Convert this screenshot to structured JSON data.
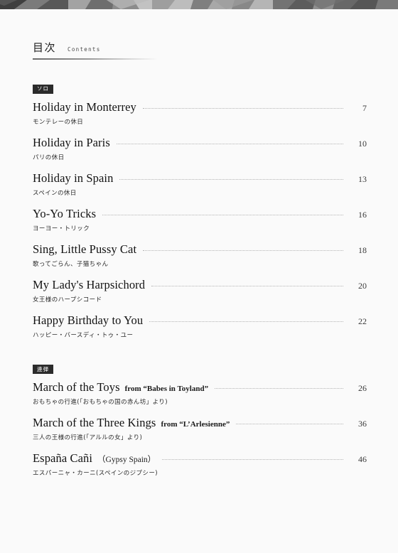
{
  "document": {
    "heading_ja": "目次",
    "heading_en": "Contents"
  },
  "sections": [
    {
      "badge": "ソロ",
      "entries": [
        {
          "title": "Holiday in Monterrey",
          "source": "",
          "subtitle_ja": "モンテレーの休日",
          "page": "7"
        },
        {
          "title": "Holiday in Paris",
          "source": "",
          "subtitle_ja": "パリの休日",
          "page": "10"
        },
        {
          "title": "Holiday in Spain",
          "source": "",
          "subtitle_ja": "スペインの休日",
          "page": "13"
        },
        {
          "title": "Yo-Yo Tricks",
          "source": "",
          "subtitle_ja": "ヨーヨー・トリック",
          "page": "16"
        },
        {
          "title": "Sing, Little Pussy Cat",
          "source": "",
          "subtitle_ja": "歌ってごらん、子猫ちゃん",
          "page": "18"
        },
        {
          "title": "My Lady's Harpsichord",
          "source": "",
          "subtitle_ja": "女王様のハープシコード",
          "page": "20"
        },
        {
          "title": "Happy Birthday to You",
          "source": "",
          "subtitle_ja": "ハッピー・バースディ・トゥ・ユー",
          "page": "22"
        }
      ]
    },
    {
      "badge": "連弾",
      "entries": [
        {
          "title": "March of the Toys",
          "source": "from “Babes in Toyland”",
          "subtitle_ja": "おもちゃの行進(「おもちゃの国の赤ん坊」より)",
          "page": "26"
        },
        {
          "title": "March of the Three Kings",
          "source": "from “L’Arlesienne”",
          "subtitle_ja": "三人の王様の行進(「アルルの女」より)",
          "page": "36"
        },
        {
          "title": "España Cañi",
          "source": "（Gypsy Spain）",
          "subtitle_ja": "エスパーニャ・カーニ(スペインのジプシー)",
          "page": "46"
        }
      ]
    }
  ],
  "colors": {
    "badge_background": "#2b2b2b",
    "badge_text": "#ffffff",
    "page_background": "#fafafa",
    "title_text": "#121212",
    "leader_dots": "#b4b4b4"
  }
}
